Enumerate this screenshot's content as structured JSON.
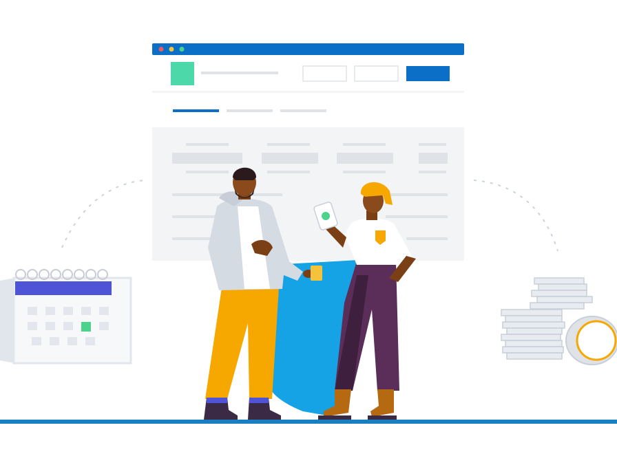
{
  "illustration": {
    "colors": {
      "browser_bar": "#0b6fc7",
      "dot_red": "#ef5b5b",
      "dot_yellow": "#f5c33b",
      "dot_green": "#4cd28a",
      "logo_tile": "#4cd8a8",
      "primary_button": "#0b6fc7",
      "placeholder_gray": "#dfe3e8",
      "panel_bg": "#f3f4f6",
      "cape_blue": "#16a3e6",
      "pants_yellow": "#f6a800",
      "pants_purple": "#5b2e5a",
      "skin": "#8a4a1c",
      "hair_yellow": "#f6a800",
      "ground_line": "#1a7fc0",
      "calendar_header": "#4f54d6",
      "calendar_highlight": "#4cd28a",
      "coin_rim": "#f6a800"
    },
    "icons": [
      "calendar-icon",
      "coin-stack-icon",
      "phone-icon",
      "coffee-cup-icon"
    ]
  }
}
